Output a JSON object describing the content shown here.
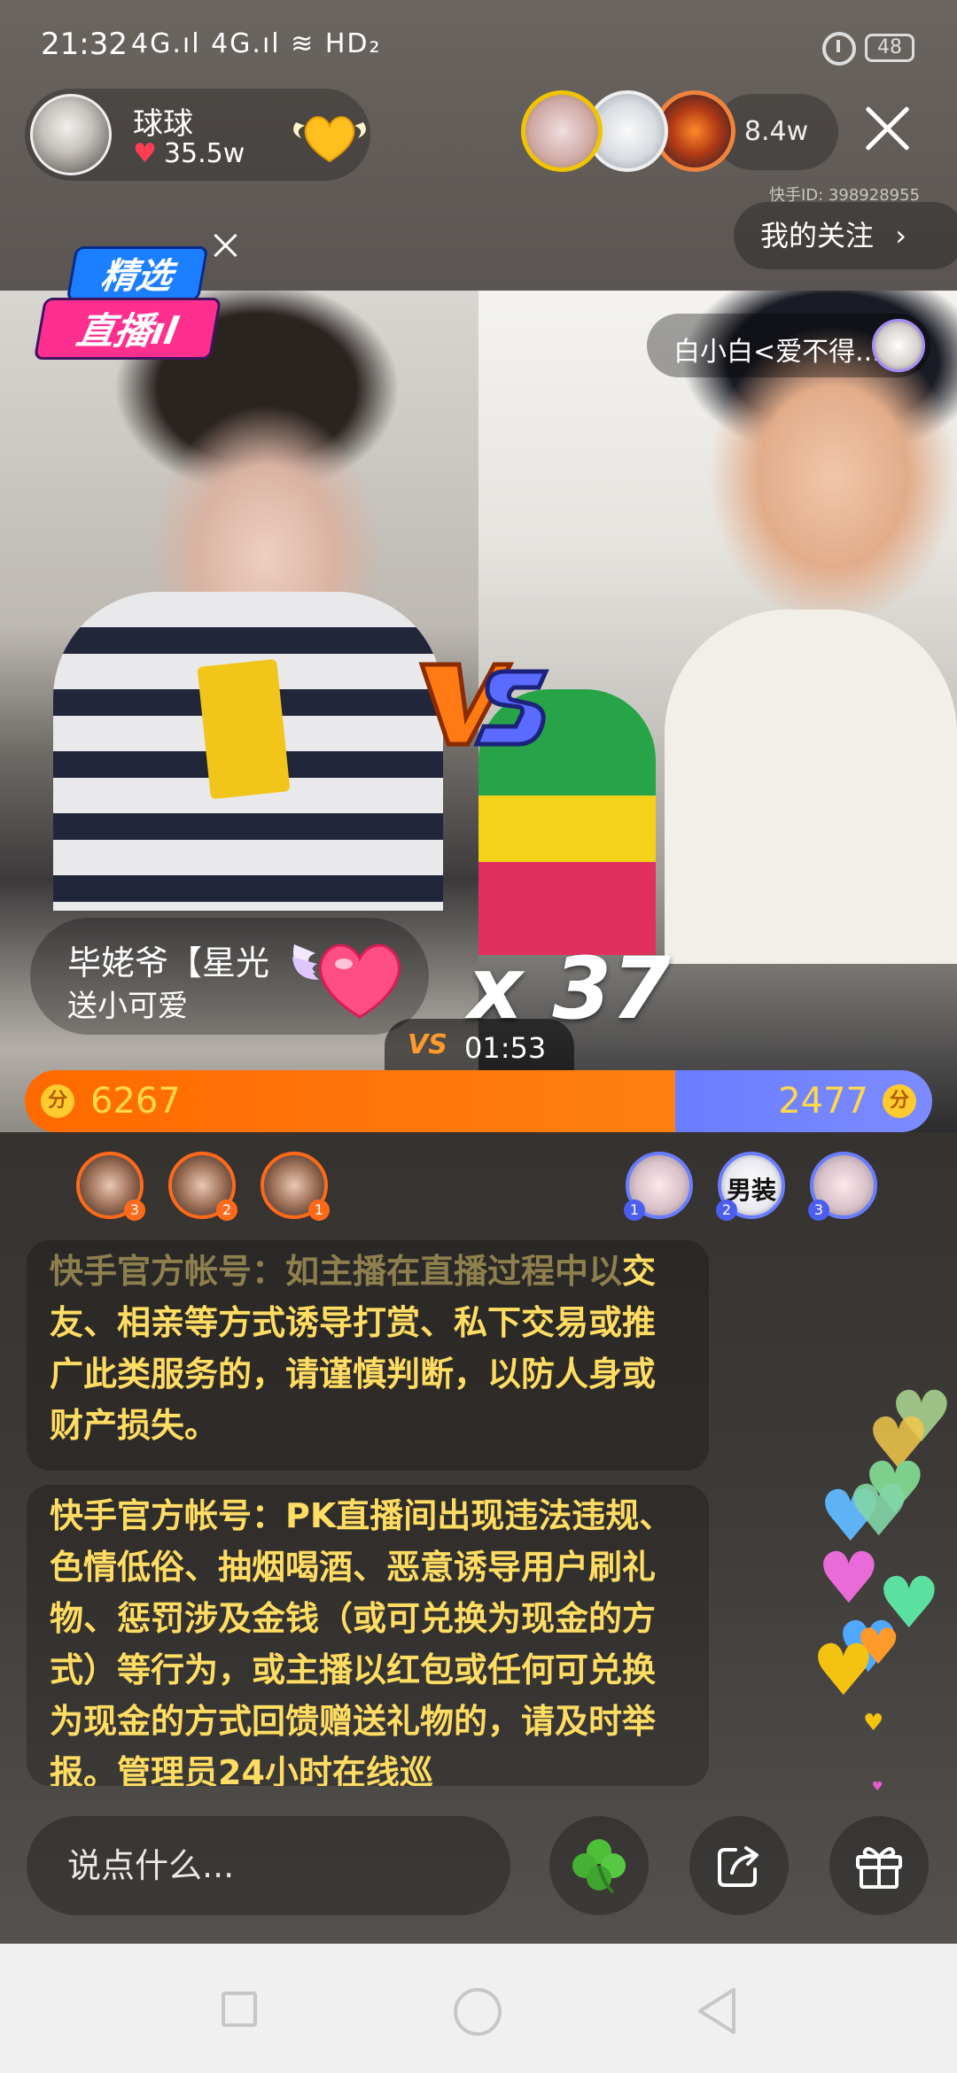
{
  "status_bar": {
    "time": "21:32",
    "network": "4G.ıl 4G.ıl ≋ HD₂",
    "battery": "48"
  },
  "host": {
    "name": "球球",
    "likes": "35.5w"
  },
  "viewers": {
    "count": "8.4w"
  },
  "kuaishou_id": "快手ID: 398928955",
  "follow_button": {
    "label": "我的关注",
    "chevron": "›"
  },
  "badge": {
    "line1": "精选",
    "line2": "直播ıl"
  },
  "opponent": {
    "name": "白小白<爱不得..."
  },
  "gift_notice": {
    "user": "毕姥爷【星光",
    "action": "送小可爱",
    "combo": "x 37"
  },
  "pk": {
    "timer": "01:53",
    "left_score": 6267,
    "right_score": 2477,
    "score_icon": "分",
    "vs_label": "VS"
  },
  "rank": {
    "left": [
      {
        "num": "3"
      },
      {
        "num": "2"
      },
      {
        "num": "1"
      }
    ],
    "right": [
      {
        "num": "1"
      },
      {
        "num": "2",
        "label": "男装"
      },
      {
        "num": "3"
      }
    ]
  },
  "notices": [
    {
      "text_faded": "快手官方帐号：如主播在直播过程中以",
      "text": "交友、相亲等方式诱导打赏、私下交易或推广此类服务的，请谨慎判断，以防人身或财产损失。"
    },
    {
      "text": "快手官方帐号：PK直播间出现违法违规、色情低俗、抽烟喝酒、恶意诱导用户刷礼物、惩罚涉及金钱（或可兑换为现金的方式）等行为，或主播以红包或任何可兑换为现金的方式回馈赠送礼物的，请及时举报。管理员24小时在线巡"
    }
  ],
  "comment_input": {
    "placeholder": "说点什么..."
  },
  "icons": {
    "clover": "clover-icon",
    "share": "share-icon",
    "gift": "gift-icon",
    "close": "close-icon"
  },
  "colors": {
    "left_team": "#ff7a0a",
    "right_team": "#7282ff",
    "notice_text": "#ffdc62",
    "score_text": "#ffd84a"
  }
}
